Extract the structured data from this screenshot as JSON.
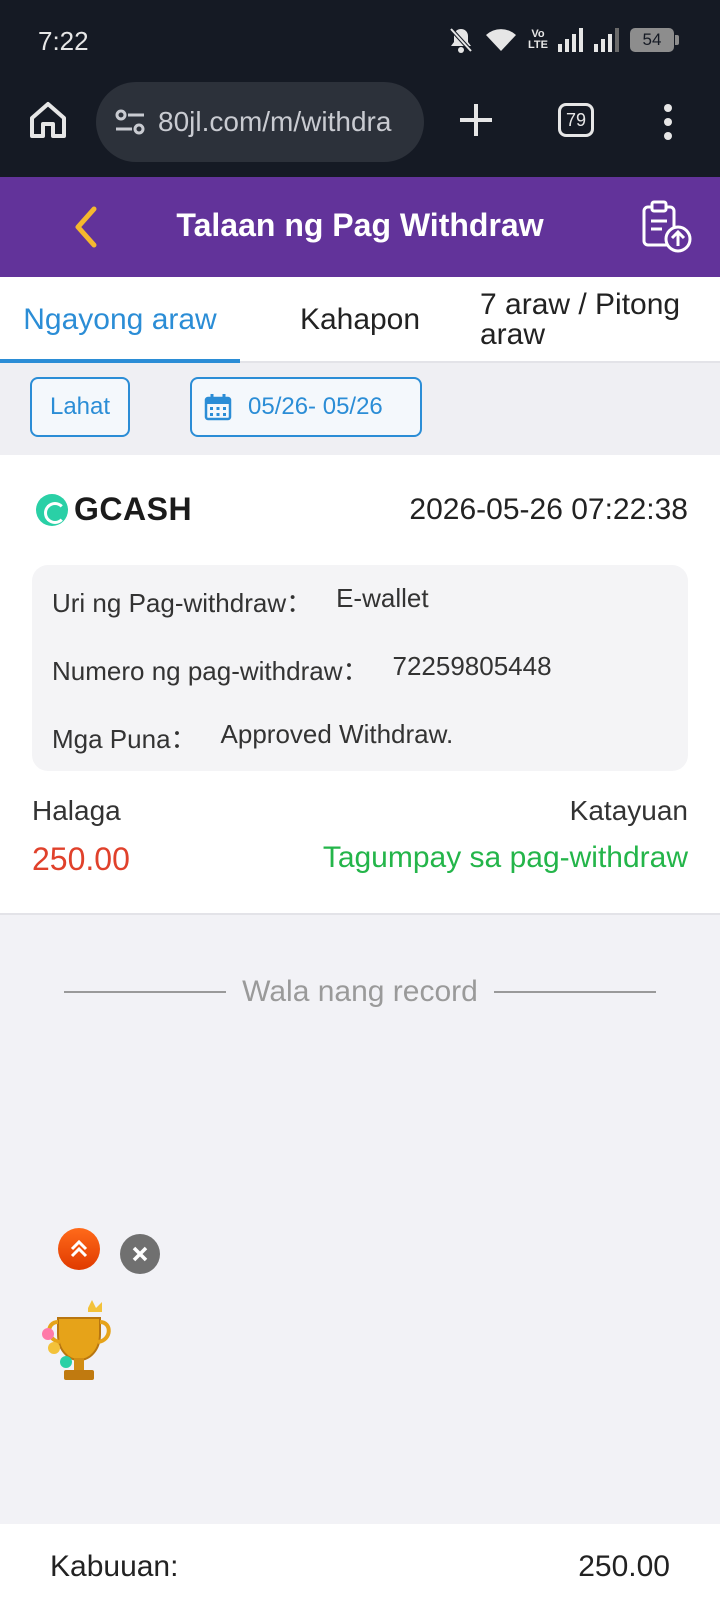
{
  "status_bar": {
    "time": "7:22",
    "volte_line1": "Vo",
    "volte_line2": "LTE",
    "battery": "54"
  },
  "browser": {
    "url": "80jl.com/m/withdra",
    "tab_count": "79"
  },
  "header": {
    "title": "Talaan ng Pag Withdraw",
    "accent_color": "#62339a"
  },
  "tabs": [
    {
      "label": "Ngayong araw",
      "active": true
    },
    {
      "label": "Kahapon",
      "active": false
    },
    {
      "label": "7 araw / Pitong araw",
      "active": false
    }
  ],
  "filters": {
    "type_label": "Lahat",
    "date_range": "05/26- 05/26"
  },
  "record": {
    "provider": "GCASH",
    "datetime": "2026-05-26 07:22:38",
    "details": [
      {
        "label": "Uri ng Pag-withdraw：",
        "value": "E-wallet"
      },
      {
        "label": "Numero ng pag-withdraw：",
        "value": "72259805448"
      },
      {
        "label": "Mga Puna：",
        "value": "Approved Withdraw."
      }
    ],
    "amount_label": "Halaga",
    "amount": "250.00",
    "status_label": "Katayuan",
    "status": "Tagumpay sa pag-withdraw",
    "status_color": "#24b54a",
    "amount_color": "#e0412b"
  },
  "empty_text": "Wala nang record",
  "total": {
    "label": "Kabuuan:",
    "value": "250.00"
  }
}
